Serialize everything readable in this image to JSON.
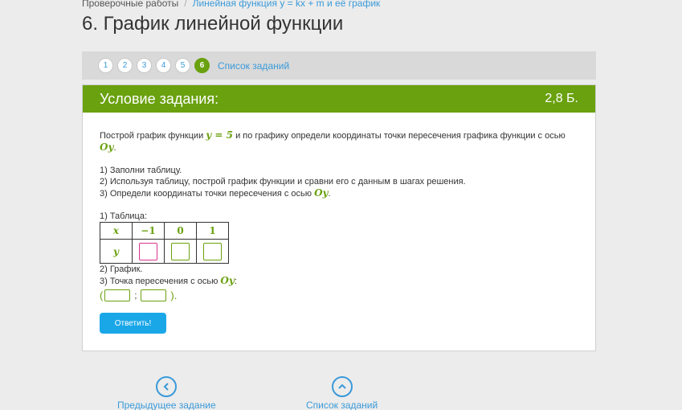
{
  "breadcrumb": {
    "root": "Проверочные работы",
    "separator": "/",
    "current": "Линейная функция y = kx + m и её график"
  },
  "page_title": "6. График линейной функции",
  "task_nav": {
    "numbers": [
      "1",
      "2",
      "3",
      "4",
      "5",
      "6"
    ],
    "active_index": 5,
    "list_link": "Список заданий"
  },
  "panel": {
    "title": "Условие задания:",
    "score": "2,8 Б.",
    "statement": {
      "pre": "Построй график функции ",
      "formula": "y = 5",
      "mid": " и по графику определи координаты точки пересечения графика функции с осью ",
      "axis": "Oy",
      "end": "."
    },
    "steps": {
      "s1": "1) Заполни таблицу.",
      "s2": "2) Используя таблицу, построй график функции и сравни его с данным в шагах решения.",
      "s3_pre": "3) Определи координаты точки пересечения с осью ",
      "s3_axis": "Oy",
      "s3_end": "."
    },
    "table_label": "1) Таблица:",
    "table": {
      "x_label": "x",
      "y_label": "y",
      "x_values": [
        "−1",
        "0",
        "1"
      ]
    },
    "graph_label": "2) График.",
    "intersection": {
      "pre": "3) Точка пересечения с осью ",
      "axis": "Oy",
      "end": ":",
      "open": "(",
      "semicolon": ";",
      "close": ")."
    },
    "submit_label": "Ответить!"
  },
  "bottom_nav": {
    "prev_label": "Предыдущее задание",
    "list_label": "Список заданий"
  },
  "colors": {
    "accent_green": "#6aa10f",
    "link_blue": "#3a9ad9",
    "button_blue": "#1aa7e8",
    "focused_input": "#d9338e"
  }
}
